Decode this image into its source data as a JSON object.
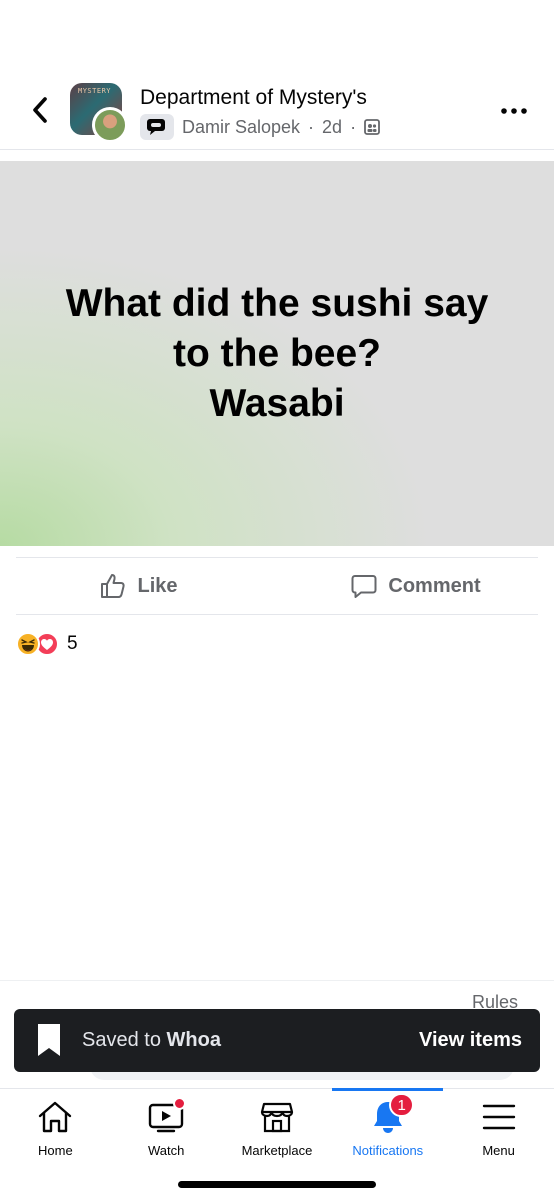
{
  "header": {
    "back_icon": "chevron-left-icon",
    "group_name": "Department of Mystery's",
    "author": "Damir Salopek",
    "separator": "·",
    "time": "2d",
    "audience_icon": "group-members-icon",
    "more_icon": "more-horizontal-icon",
    "group_avatar_text": "MYSTERY"
  },
  "post": {
    "text_lines": [
      "What did the sushi say",
      "to the bee?",
      "Wasabi"
    ],
    "background_colors": [
      "#dedede",
      "#b6dba3"
    ]
  },
  "actions": {
    "like_label": "Like",
    "comment_label": "Comment"
  },
  "reactions": {
    "types": [
      "haha",
      "love"
    ],
    "count": "5"
  },
  "rules_label": "Rules",
  "toast": {
    "message_prefix": "Saved to",
    "collection": "Whoa",
    "action_label": "View items"
  },
  "tabs": [
    {
      "label": "Home",
      "icon": "home-icon",
      "active": false
    },
    {
      "label": "Watch",
      "icon": "watch-video-icon",
      "active": false,
      "dot": true
    },
    {
      "label": "Marketplace",
      "icon": "marketplace-store-icon",
      "active": false
    },
    {
      "label": "Notifications",
      "icon": "bell-icon",
      "active": true,
      "badge": "1"
    },
    {
      "label": "Menu",
      "icon": "hamburger-menu-icon",
      "active": false
    }
  ],
  "colors": {
    "accent": "#1877f2",
    "badge_red": "#e41e3f",
    "toast_bg": "#1c1e21",
    "secondary_text": "#65676b"
  }
}
